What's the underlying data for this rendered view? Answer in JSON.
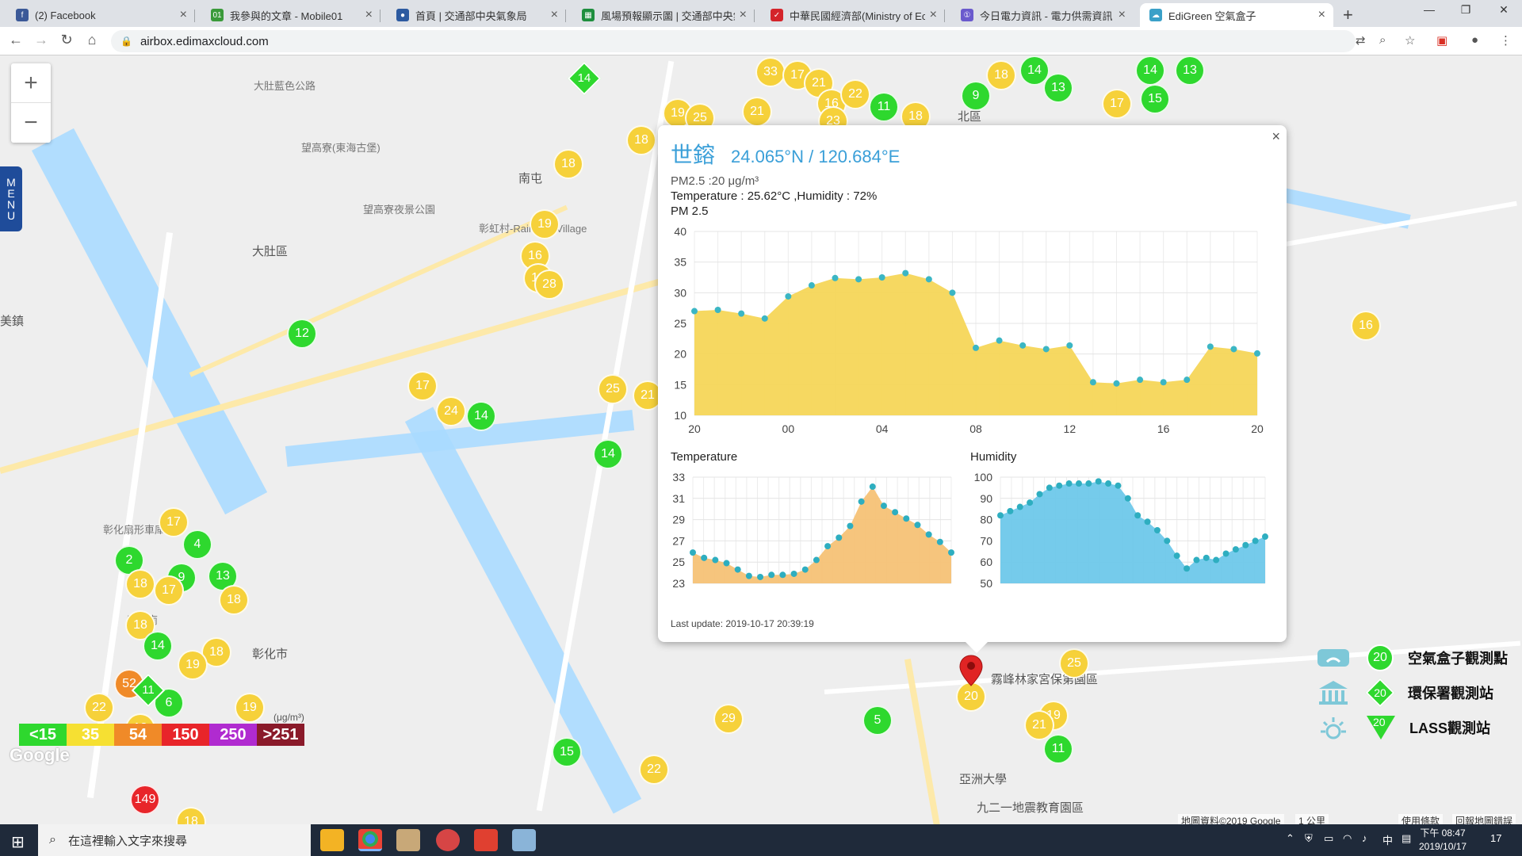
{
  "browser": {
    "tabs": [
      {
        "title": "(2) Facebook",
        "icon": "facebook-icon",
        "color": "#3b5998",
        "glyph": "f"
      },
      {
        "title": "我參與的文章 - Mobile01",
        "icon": "mobile01-icon",
        "color": "#3a9a3a",
        "glyph": "01"
      },
      {
        "title": "首頁 | 交通部中央氣象局",
        "icon": "cwb-icon",
        "color": "#2c5aa0",
        "glyph": "●"
      },
      {
        "title": "風場預報顯示圖 | 交通部中央氣象局",
        "icon": "sheet-icon",
        "color": "#1e8e3e",
        "glyph": "▦"
      },
      {
        "title": "中華民國經濟部(Ministry of Economic Affairs)",
        "icon": "moea-icon",
        "color": "#d4242a",
        "glyph": "✓"
      },
      {
        "title": "今日電力資訊 - 電力供需資訊 - 台灣電力公司",
        "icon": "taipower-icon",
        "color": "#6a5acd",
        "glyph": "①"
      },
      {
        "title": "EdiGreen 空氣盒子",
        "icon": "edigreen-icon",
        "color": "#3aa0c8",
        "glyph": "☁"
      }
    ],
    "address": "airbox.edimaxcloud.com",
    "new_tab": "+",
    "minimize": "—",
    "maximize": "❐",
    "close": "✕"
  },
  "map": {
    "zoom_in": "+",
    "zoom_out": "−",
    "menu_letters": [
      "M",
      "E",
      "N",
      "U"
    ],
    "places": [
      {
        "text": "大肚區",
        "x": 318,
        "y": 236
      },
      {
        "text": "彰化市",
        "x": 318,
        "y": 744
      },
      {
        "text": "美鎮",
        "x": 0,
        "y": 324
      },
      {
        "text": "南屯",
        "x": 654,
        "y": 144
      },
      {
        "text": "北區",
        "x": 1208,
        "y": 66
      },
      {
        "text": "霧峰林家宮保第園區",
        "x": 1250,
        "y": 776
      },
      {
        "text": "亞洲大學",
        "x": 1210,
        "y": 902
      },
      {
        "text": "九二一地震教育園區",
        "x": 1232,
        "y": 938
      },
      {
        "text": "大肚藍色公路",
        "x": 320,
        "y": 28
      },
      {
        "text": "望高寮(東海古堡)",
        "x": 380,
        "y": 106
      },
      {
        "text": "望高寮夜景公園",
        "x": 458,
        "y": 184
      },
      {
        "text": "彰虹村-Rainbow Village",
        "x": 604,
        "y": 208
      },
      {
        "text": "彰化扇形車庫",
        "x": 130,
        "y": 588
      },
      {
        "text": "彰化南",
        "x": 160,
        "y": 702
      }
    ],
    "markers": [
      {
        "v": "33",
        "c": "y",
        "x": 953,
        "y": 2
      },
      {
        "v": "17",
        "c": "y",
        "x": 987,
        "y": 6
      },
      {
        "v": "21",
        "c": "y",
        "x": 1014,
        "y": 16
      },
      {
        "v": "16",
        "c": "y",
        "x": 1030,
        "y": 42
      },
      {
        "v": "22",
        "c": "y",
        "x": 1060,
        "y": 30
      },
      {
        "v": "11",
        "c": "g",
        "x": 1096,
        "y": 46
      },
      {
        "v": "18",
        "c": "y",
        "x": 1136,
        "y": 58
      },
      {
        "v": "9",
        "c": "g",
        "x": 1212,
        "y": 32
      },
      {
        "v": "18",
        "c": "y",
        "x": 1244,
        "y": 6
      },
      {
        "v": "14",
        "c": "g",
        "x": 1286,
        "y": 0
      },
      {
        "v": "13",
        "c": "g",
        "x": 1316,
        "y": 22
      },
      {
        "v": "17",
        "c": "y",
        "x": 1390,
        "y": 42
      },
      {
        "v": "15",
        "c": "g",
        "x": 1438,
        "y": 36
      },
      {
        "v": "14",
        "c": "g",
        "x": 1432,
        "y": 0
      },
      {
        "v": "13",
        "c": "g",
        "x": 1482,
        "y": 0
      },
      {
        "v": "19",
        "c": "y",
        "x": 836,
        "y": 54
      },
      {
        "v": "25",
        "c": "y",
        "x": 864,
        "y": 60
      },
      {
        "v": "21",
        "c": "y",
        "x": 936,
        "y": 52
      },
      {
        "v": "23",
        "c": "y",
        "x": 1032,
        "y": 64
      },
      {
        "v": "18",
        "c": "y",
        "x": 790,
        "y": 88
      },
      {
        "v": "18",
        "c": "y",
        "x": 698,
        "y": 118
      },
      {
        "v": "19",
        "c": "y",
        "x": 668,
        "y": 194
      },
      {
        "v": "16",
        "c": "y",
        "x": 656,
        "y": 234
      },
      {
        "v": "18",
        "c": "y",
        "x": 660,
        "y": 262
      },
      {
        "v": "28",
        "c": "y",
        "x": 674,
        "y": 270
      },
      {
        "v": "12",
        "c": "g",
        "x": 362,
        "y": 332
      },
      {
        "v": "17",
        "c": "y",
        "x": 514,
        "y": 398
      },
      {
        "v": "24",
        "c": "y",
        "x": 550,
        "y": 430
      },
      {
        "v": "14",
        "c": "g",
        "x": 588,
        "y": 436
      },
      {
        "v": "25",
        "c": "y",
        "x": 754,
        "y": 402
      },
      {
        "v": "21",
        "c": "y",
        "x": 798,
        "y": 410
      },
      {
        "v": "14",
        "c": "g",
        "x": 748,
        "y": 484
      },
      {
        "v": "17",
        "c": "y",
        "x": 200,
        "y": 570
      },
      {
        "v": "4",
        "c": "g",
        "x": 230,
        "y": 598
      },
      {
        "v": "2",
        "c": "g",
        "x": 144,
        "y": 618
      },
      {
        "v": "18",
        "c": "y",
        "x": 158,
        "y": 648
      },
      {
        "v": "9",
        "c": "g",
        "x": 210,
        "y": 640
      },
      {
        "v": "17",
        "c": "y",
        "x": 194,
        "y": 656
      },
      {
        "v": "13",
        "c": "g",
        "x": 262,
        "y": 638
      },
      {
        "v": "18",
        "c": "y",
        "x": 276,
        "y": 668
      },
      {
        "v": "18",
        "c": "y",
        "x": 158,
        "y": 700
      },
      {
        "v": "14",
        "c": "g",
        "x": 180,
        "y": 726
      },
      {
        "v": "18",
        "c": "y",
        "x": 254,
        "y": 734
      },
      {
        "v": "19",
        "c": "y",
        "x": 224,
        "y": 750
      },
      {
        "v": "52",
        "c": "o",
        "x": 144,
        "y": 774
      },
      {
        "v": "22",
        "c": "y",
        "x": 106,
        "y": 804
      },
      {
        "v": "6",
        "c": "g",
        "x": 194,
        "y": 798
      },
      {
        "v": "18",
        "c": "y",
        "x": 158,
        "y": 830
      },
      {
        "v": "19",
        "c": "y",
        "x": 296,
        "y": 804
      },
      {
        "v": "29",
        "c": "y",
        "x": 900,
        "y": 818
      },
      {
        "v": "15",
        "c": "g",
        "x": 696,
        "y": 860
      },
      {
        "v": "22",
        "c": "y",
        "x": 806,
        "y": 882
      },
      {
        "v": "5",
        "c": "g",
        "x": 1088,
        "y": 820
      },
      {
        "v": "20",
        "c": "y",
        "x": 1206,
        "y": 790
      },
      {
        "v": "25",
        "c": "y",
        "x": 1336,
        "y": 748
      },
      {
        "v": "19",
        "c": "y",
        "x": 1310,
        "y": 814
      },
      {
        "v": "21",
        "c": "y",
        "x": 1292,
        "y": 826
      },
      {
        "v": "11",
        "c": "g",
        "x": 1316,
        "y": 856
      },
      {
        "v": "16",
        "c": "y",
        "x": 1704,
        "y": 322
      },
      {
        "v": "149",
        "c": "r",
        "x": 164,
        "y": 920
      },
      {
        "v": "18",
        "c": "y",
        "x": 222,
        "y": 948
      }
    ],
    "diamonds": [
      {
        "v": "14",
        "x": 722,
        "y": 14
      },
      {
        "v": "11",
        "x": 172,
        "y": 786
      }
    ],
    "legend": {
      "segments": [
        {
          "label": "<15",
          "color": "#2ed82e"
        },
        {
          "label": "35",
          "color": "#f6e032"
        },
        {
          "label": "54",
          "color": "#f08a28"
        },
        {
          "label": "150",
          "color": "#e8252a"
        },
        {
          "label": "250",
          "color": "#b02bd0"
        },
        {
          "label": ">251",
          "color": "#8a1a2a"
        }
      ],
      "unit": "(μg/m³)"
    },
    "station_legend": [
      {
        "value": "20",
        "label": "空氣盒子觀測點"
      },
      {
        "value": "20",
        "label": "環保署觀測站"
      },
      {
        "value": "20",
        "label": "LASS觀測站"
      }
    ],
    "google_logo": "Google",
    "attribution": "地圖資料©2019 Google",
    "scale": "1 公里",
    "terms": "使用條款",
    "report": "回報地圖錯誤"
  },
  "popup": {
    "close": "×",
    "name": "世鎔",
    "coords": "24.065°N / 120.684°E",
    "pm_line": "PM2.5 :20 μg/m³",
    "th_line": "Temperature : 25.62°C ,Humidity : 72%",
    "chart_title": "PM 2.5",
    "temp_title": "Temperature",
    "hum_title": "Humidity",
    "last_update": "Last update: 2019-10-17 20:39:19"
  },
  "chart_data": [
    {
      "type": "area",
      "title": "PM 2.5",
      "x": [
        "20",
        "00",
        "04",
        "08",
        "12",
        "16",
        "20"
      ],
      "ylim": [
        10,
        40
      ],
      "yticks": [
        10,
        15,
        20,
        25,
        30,
        35,
        40
      ],
      "grid": true,
      "color": "#f6d658",
      "series": [
        {
          "values": [
            27,
            27.2,
            26.6,
            25.8,
            29.4,
            31.2,
            32.4,
            32.2,
            32.5,
            33.2,
            32.2,
            30,
            21,
            22.2,
            21.4,
            20.8,
            21.4,
            15.4,
            15.2,
            15.8,
            15.4,
            15.8,
            21.2,
            20.8,
            20.1
          ]
        }
      ]
    },
    {
      "type": "area",
      "title": "Temperature",
      "ylim": [
        23,
        33
      ],
      "yticks": [
        23,
        25,
        27,
        29,
        31,
        33
      ],
      "grid": true,
      "color": "#f6c276",
      "series": [
        {
          "values": [
            25.9,
            25.4,
            25.2,
            24.9,
            24.3,
            23.7,
            23.6,
            23.8,
            23.8,
            23.9,
            24.3,
            25.2,
            26.5,
            27.3,
            28.4,
            30.7,
            32.1,
            30.3,
            29.7,
            29.1,
            28.5,
            27.6,
            26.9,
            25.9
          ]
        }
      ]
    },
    {
      "type": "area",
      "title": "Humidity",
      "ylim": [
        50,
        100
      ],
      "yticks": [
        50,
        60,
        70,
        80,
        90,
        100
      ],
      "grid": true,
      "color": "#6ec8ea",
      "series": [
        {
          "values": [
            82,
            84,
            86,
            88,
            92,
            95,
            96,
            97,
            97,
            97,
            98,
            97,
            96,
            90,
            82,
            79,
            75,
            70,
            63,
            57,
            61,
            62,
            61,
            64,
            66,
            68,
            70,
            72
          ]
        }
      ]
    }
  ],
  "taskbar": {
    "search_placeholder": "在這裡輸入文字來搜尋",
    "tray_ime": "中",
    "clock_time": "下午 08:47",
    "clock_date": "2019/10/17",
    "notification_count": "17"
  }
}
